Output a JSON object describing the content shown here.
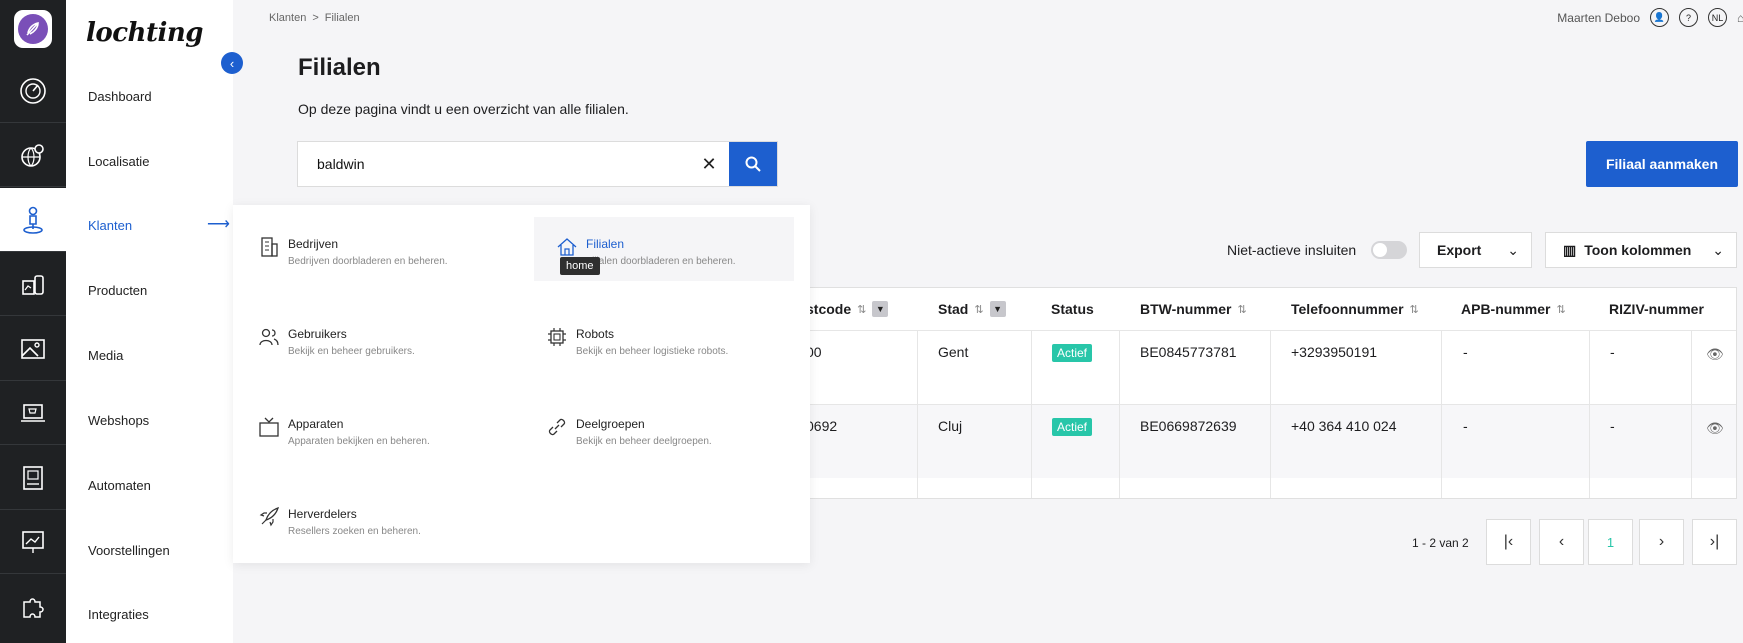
{
  "brand": "lochting",
  "nav": {
    "items": [
      {
        "label": "Dashboard",
        "icon": "speedometer-icon"
      },
      {
        "label": "Localisatie",
        "icon": "globe-pin-icon"
      },
      {
        "label": "Klanten",
        "icon": "person-pin-icon"
      },
      {
        "label": "Producten",
        "icon": "products-icon"
      },
      {
        "label": "Media",
        "icon": "image-icon"
      },
      {
        "label": "Webshops",
        "icon": "laptop-cart-icon"
      },
      {
        "label": "Automaten",
        "icon": "vending-machine-icon"
      },
      {
        "label": "Voorstellingen",
        "icon": "presentation-icon"
      },
      {
        "label": "Integraties",
        "icon": "puzzle-icon"
      }
    ],
    "active": "Klanten"
  },
  "breadcrumb": {
    "first": "Klanten",
    "separator": ">",
    "current": "Filialen"
  },
  "user": {
    "name": "Maarten Deboo",
    "help": "?",
    "lang": "NL"
  },
  "page": {
    "title": "Filialen",
    "subtitle": "Op deze pagina vindt u een overzicht van alle filialen."
  },
  "search": {
    "value": "baldwin"
  },
  "create_button": "Filiaal aanmaken",
  "filters": {
    "inactive_label": "Niet-actieve insluiten",
    "export_label": "Export",
    "columns_label": "Toon kolommen"
  },
  "menu": {
    "items": [
      {
        "title": "Bedrijven",
        "desc": "Bedrijven doorbladeren en beheren.",
        "icon": "building-icon"
      },
      {
        "title": "Filialen",
        "desc": "Filialen doorbladeren en beheren.",
        "icon": "home-icon"
      },
      {
        "title": "Gebruikers",
        "desc": "Bekijk en beheer gebruikers.",
        "icon": "users-icon"
      },
      {
        "title": "Robots",
        "desc": "Bekijk en beheer logistieke robots.",
        "icon": "chip-icon"
      },
      {
        "title": "Apparaten",
        "desc": "Apparaten bekijken en beheren.",
        "icon": "tv-icon"
      },
      {
        "title": "Deelgroepen",
        "desc": "Bekijk en beheer deelgroepen.",
        "icon": "link-icon"
      },
      {
        "title": "Herverdelers",
        "desc": "Resellers zoeken en beheren.",
        "icon": "rocket-icon"
      }
    ],
    "tooltip": "home"
  },
  "table": {
    "headers": {
      "postcode": "stcode",
      "stad": "Stad",
      "status": "Status",
      "btw": "BTW-nummer",
      "telefoon": "Telefoonnummer",
      "apb": "APB-nummer",
      "riziv": "RIZIV-nummer"
    },
    "rows": [
      {
        "postcode": "00",
        "stad": "Gent",
        "status": "Actief",
        "btw": "BE0845773781",
        "telefoon": "+3293950191",
        "apb": "-",
        "riziv": "-"
      },
      {
        "postcode": "0692",
        "stad": "Cluj",
        "status": "Actief",
        "btw": "BE0669872639",
        "telefoon": "+40 364 410 024",
        "apb": "-",
        "riziv": "-"
      }
    ]
  },
  "pagination": {
    "info": "1 - 2 van 2",
    "current_page": "1"
  },
  "colors": {
    "accent": "#1d5fcf",
    "badge": "#28c6a9",
    "rail": "#1f2123",
    "logo": "#7a4fb8"
  }
}
